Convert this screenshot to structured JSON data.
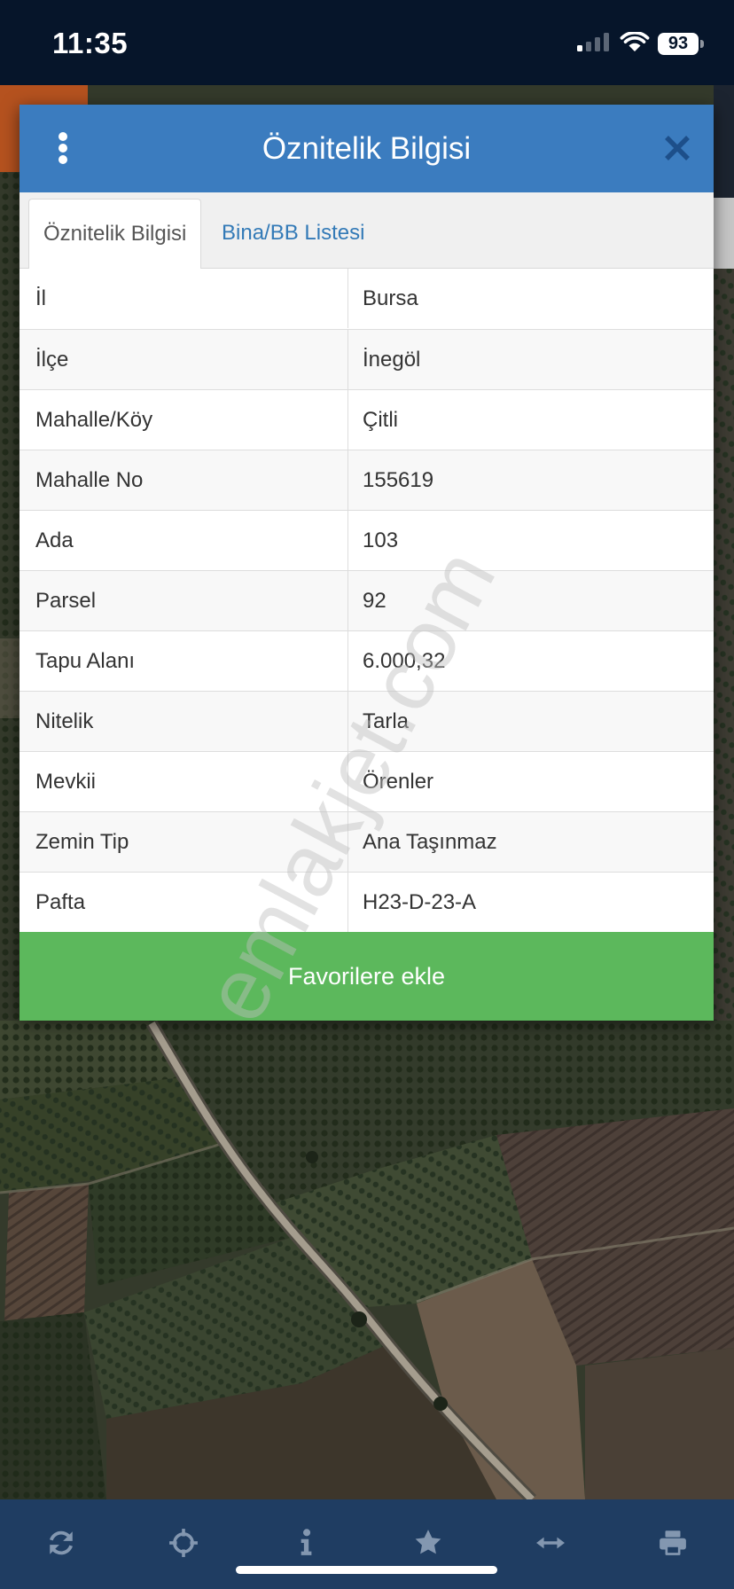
{
  "status_bar": {
    "time": "11:35",
    "signal_icon": "cellular-signal-icon",
    "signal_bars_active": 1,
    "wifi_icon": "wifi-icon",
    "battery_icon": "battery-icon",
    "battery_level": "93"
  },
  "modal": {
    "title": "Öznitelik Bilgisi",
    "menu_icon": "vertical-ellipsis-icon",
    "close_icon": "close-icon",
    "tabs": [
      {
        "label": "Öznitelik Bilgisi",
        "active": true
      },
      {
        "label": "Bina/BB Listesi",
        "active": false
      }
    ],
    "attributes": [
      {
        "key": "İl",
        "value": "Bursa"
      },
      {
        "key": "İlçe",
        "value": "İnegöl"
      },
      {
        "key": "Mahalle/Köy",
        "value": "Çitli"
      },
      {
        "key": "Mahalle No",
        "value": "155619"
      },
      {
        "key": "Ada",
        "value": "103"
      },
      {
        "key": "Parsel",
        "value": "92"
      },
      {
        "key": "Tapu Alanı",
        "value": "6.000,32"
      },
      {
        "key": "Nitelik",
        "value": "Tarla"
      },
      {
        "key": "Mevkii",
        "value": "Örenler"
      },
      {
        "key": "Zemin Tip",
        "value": "Ana Taşınmaz"
      },
      {
        "key": "Pafta",
        "value": "H23-D-23-A"
      }
    ],
    "favorite_button_label": "Favorilere ekle"
  },
  "watermark": "emlakjet.com",
  "toolbar": {
    "items": [
      "refresh-icon",
      "crosshairs-icon",
      "info-icon",
      "star-icon",
      "arrows-horizontal-icon",
      "print-icon"
    ]
  },
  "colors": {
    "header_blue": "#3b7cbf",
    "tab_link": "#337ab7",
    "favorite_green": "#5cb85c",
    "toolbar_bg": "#1f3d62",
    "toolbar_icon": "#8397b0",
    "status_bar_bg": "#06152a",
    "accent_orange": "#b5521f",
    "close_icon": "#1d4f8a"
  }
}
